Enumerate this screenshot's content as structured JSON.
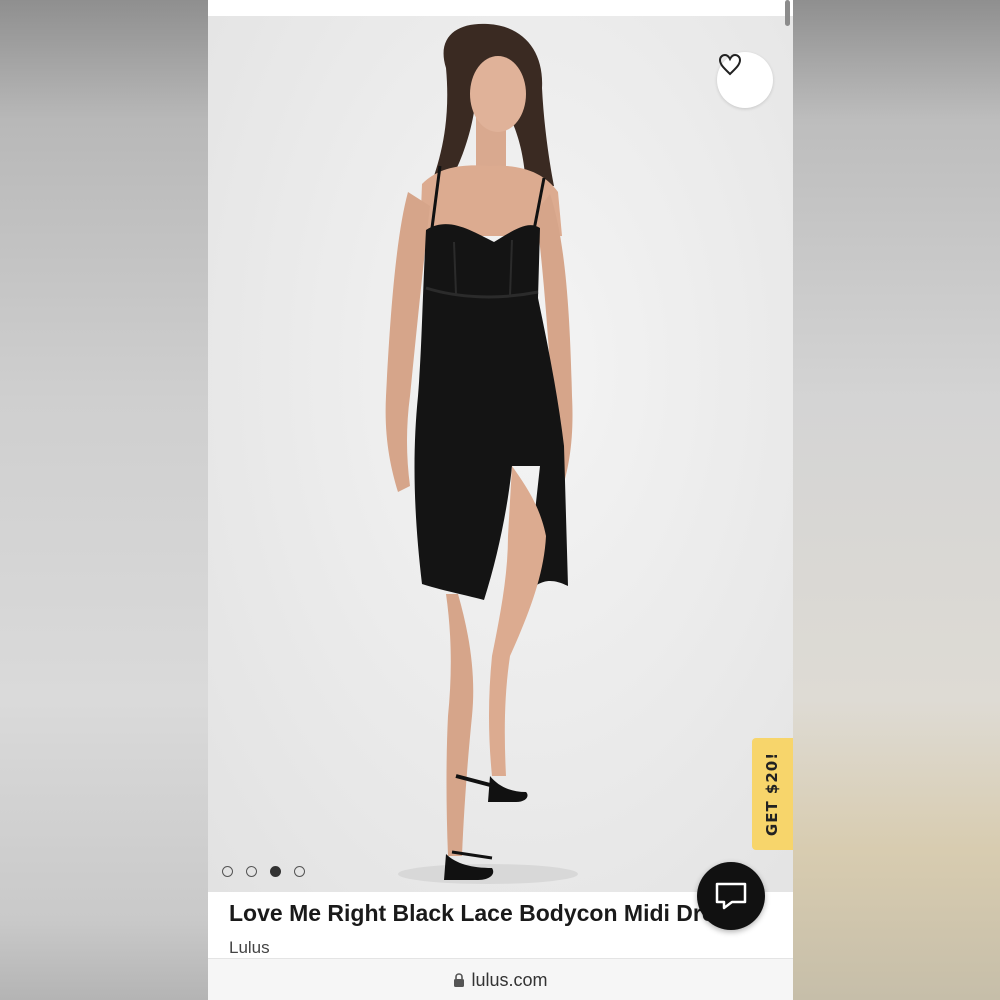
{
  "product": {
    "title": "Love Me Right Black Lace Bodycon Midi Dress",
    "brand": "Lulus"
  },
  "gallery": {
    "image_count": 4,
    "active_index": 2
  },
  "promo": {
    "label": "GET $20!",
    "color": "#f7d56b"
  },
  "browser": {
    "url": "lulus.com"
  },
  "icons": {
    "wishlist": "heart-outline-icon",
    "chat": "chat-bubble-icon",
    "lock": "lock-icon"
  }
}
